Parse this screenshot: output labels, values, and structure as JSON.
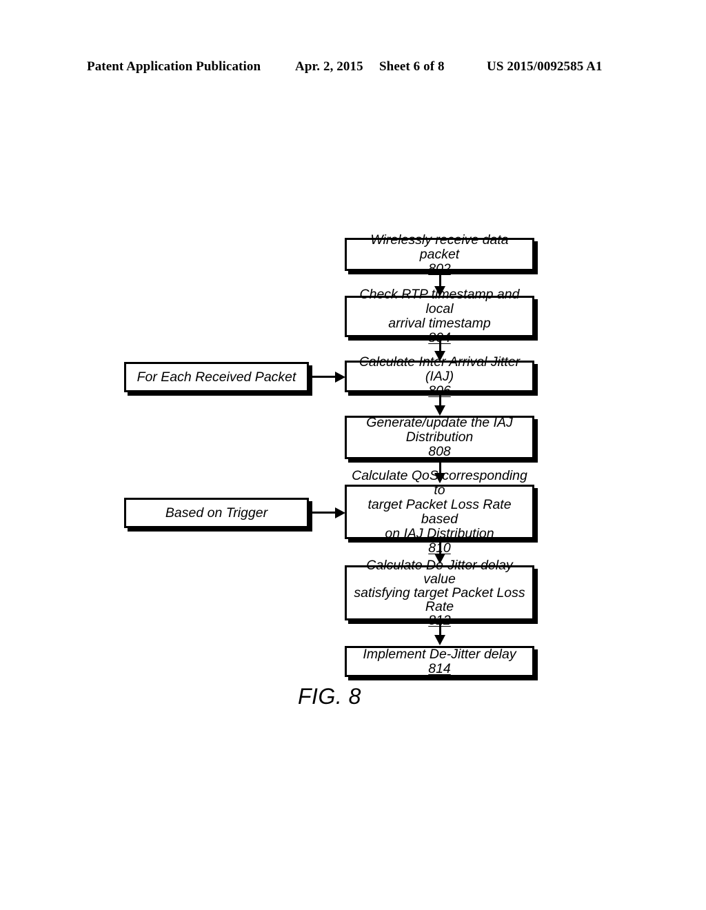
{
  "header": {
    "publication": "Patent Application Publication",
    "date": "Apr. 2, 2015",
    "sheet": "Sheet 6 of 8",
    "number": "US 2015/0092585 A1"
  },
  "figure": {
    "caption": "FIG. 8",
    "nodes": [
      {
        "id": "802",
        "label": "Wirelessly receive data packet",
        "ref": "802"
      },
      {
        "id": "804",
        "label": "Check RTP timestamp and local\narrival timestamp",
        "ref": "804"
      },
      {
        "id": "806",
        "label": "Calculate Inter Arrival Jitter (IAJ)",
        "ref": "806"
      },
      {
        "id": "808",
        "label": "Generate/update the IAJ\nDistribution",
        "ref": "808"
      },
      {
        "id": "810",
        "label": "Calculate QoS corresponding to\ntarget Packet Loss Rate based\non IAJ Distribution",
        "ref": "810"
      },
      {
        "id": "812",
        "label": "Calculate De-Jitter delay value\nsatisfying target Packet Loss\nRate",
        "ref": "812"
      },
      {
        "id": "814",
        "label": "Implement De-Jitter delay",
        "ref": "814"
      }
    ],
    "annotations": [
      {
        "id": "for-each-received-packet",
        "label": "For Each Received Packet"
      },
      {
        "id": "based-on-trigger",
        "label": "Based on Trigger"
      }
    ]
  }
}
